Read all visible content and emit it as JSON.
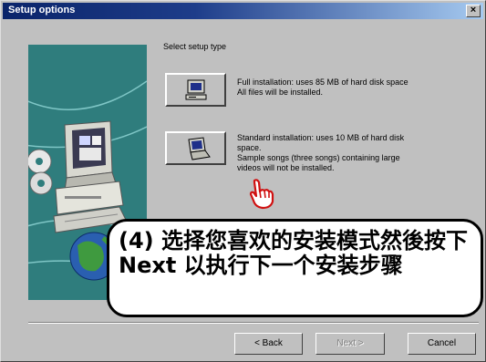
{
  "window": {
    "title": "Setup options",
    "close_glyph": "×"
  },
  "setup_type_label": "Select setup type",
  "options": [
    {
      "icon": "desktop-computer-icon",
      "lines": [
        "Full installation: uses 85 MB of hard disk space",
        "All files will be installed."
      ]
    },
    {
      "icon": "laptop-computer-icon",
      "lines": [
        "Standard installation: uses 10 MB of hard disk",
        "space.",
        "Sample songs (three songs) containing large",
        "videos will not be installed."
      ]
    }
  ],
  "callout": {
    "text": "(4) 选择您喜欢的安装模式然後按下 Next 以执行下一个安装步骤"
  },
  "buttons": {
    "back": "< Back",
    "next": "Next >",
    "cancel": "Cancel"
  },
  "colors": {
    "title_bar": "#0a246a",
    "art_panel": "#2f7d7d",
    "window_face": "#c0c0c0"
  }
}
